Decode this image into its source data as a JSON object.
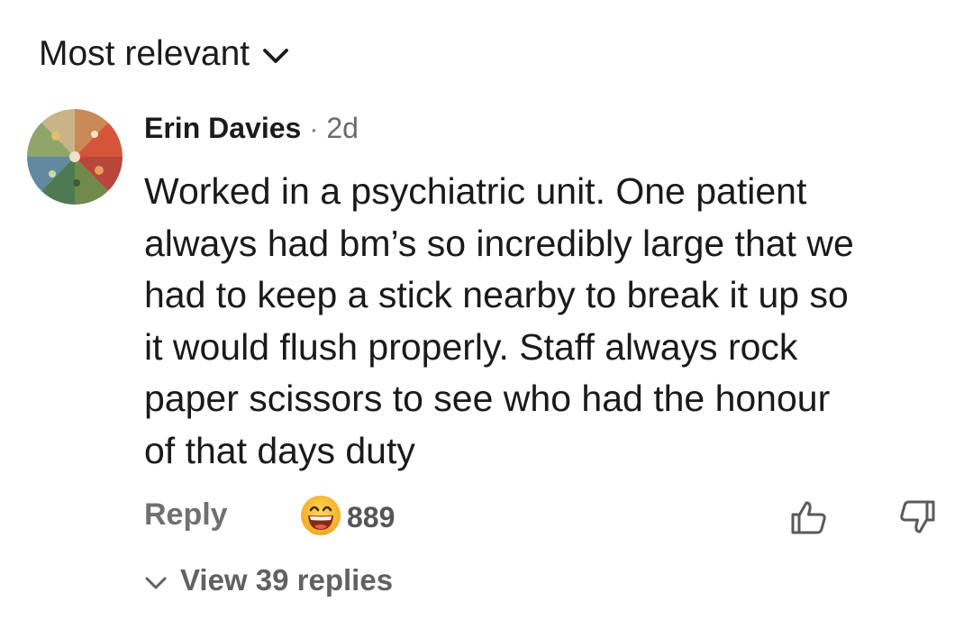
{
  "sort": {
    "label": "Most relevant",
    "icon": "chevron-down-icon"
  },
  "comment": {
    "author": "Erin Davies",
    "separator": "·",
    "time": "2d",
    "avatar_icon": "botanical-wheel-avatar",
    "text": "Worked in a psychiatric unit. One patient\nalways had bm’s so incredibly large that we\nhad to keep a stick nearby to break it up so\nit would flush properly. Staff always rock\npaper scissors to see who had the honour\nof that days duty"
  },
  "actions": {
    "reply_label": "Reply",
    "reaction_icon": "laughing-emoji-icon",
    "reaction_count": "889",
    "like_icon": "thumbs-up-icon",
    "dislike_icon": "thumbs-down-icon"
  },
  "replies": {
    "label": "View 39 replies",
    "icon": "chevron-down-icon"
  },
  "colors": {
    "text_primary": "#1b1b1b",
    "text_secondary": "#707070",
    "emoji_yellow": "#f7c233",
    "emoji_mouth": "#8b2a12"
  }
}
